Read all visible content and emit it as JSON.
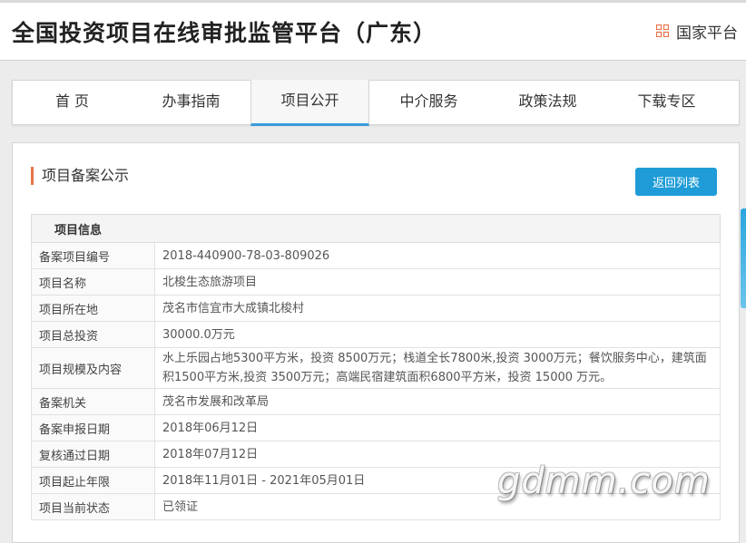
{
  "header": {
    "title": "全国投资项目在线审批监管平台（广东）",
    "national_link": "国家平台",
    "icon": "grid-icon",
    "accent_color": "#e8734a"
  },
  "nav": {
    "items": [
      "首 页",
      "办事指南",
      "项目公开",
      "中介服务",
      "政策法规",
      "下载专区"
    ],
    "active": "项目公开",
    "active_color": "#3a9ad9"
  },
  "panel": {
    "section_title": "项目备案公示",
    "back_button": "返回列表",
    "button_color": "#1f9cd7"
  },
  "table": {
    "header": "项目信息",
    "rows": [
      {
        "label": "备案项目编号",
        "value": "2018-440900-78-03-809026"
      },
      {
        "label": "项目名称",
        "value": "北梭生态旅游项目"
      },
      {
        "label": "项目所在地",
        "value": "茂名市信宜市大成镇北梭村"
      },
      {
        "label": "项目总投资",
        "value": "30000.0万元"
      },
      {
        "label": "项目规模及内容",
        "value": "水上乐园占地5300平方米，投资 8500万元；栈道全长7800米,投资 3000万元；餐饮服务中心，建筑面积1500平方米,投资 3500万元；高端民宿建筑面积6800平方米，投资 15000 万元。"
      },
      {
        "label": "备案机关",
        "value": "茂名市发展和改革局"
      },
      {
        "label": "备案申报日期",
        "value": "2018年06月12日"
      },
      {
        "label": "复核通过日期",
        "value": "2018年07月12日"
      },
      {
        "label": "项目起止年限",
        "value": "2018年11月01日 - 2021年05月01日"
      },
      {
        "label": "项目当前状态",
        "value": "已领证"
      }
    ]
  },
  "watermark": "gdmm.com"
}
